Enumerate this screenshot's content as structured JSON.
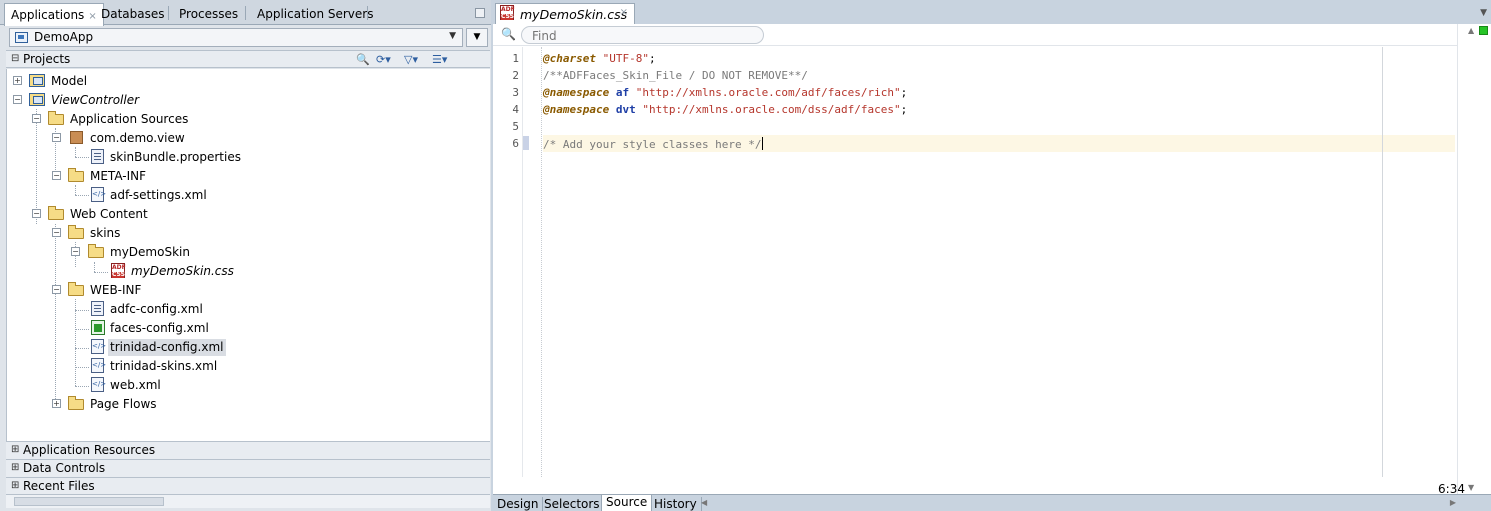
{
  "left_panel": {
    "tabs": [
      {
        "label": "Applications",
        "active": true,
        "close": "×"
      },
      {
        "label": "Databases",
        "active": false
      },
      {
        "label": "Processes",
        "active": false
      },
      {
        "label": "Application Servers",
        "active": false
      }
    ],
    "application": "DemoApp",
    "projects_label": "Projects",
    "tree": {
      "model": "Model",
      "view_controller": "ViewController",
      "application_sources": "Application Sources",
      "com_demo_view": "com.demo.view",
      "skin_bundle": "skinBundle.properties",
      "meta_inf": "META-INF",
      "adf_settings": "adf-settings.xml",
      "web_content": "Web Content",
      "skins": "skins",
      "my_demo_skin_folder": "myDemoSkin",
      "my_demo_skin_css": "myDemoSkin.css",
      "web_inf": "WEB-INF",
      "adfc_config": "adfc-config.xml",
      "faces_config": "faces-config.xml",
      "trinidad_config": "trinidad-config.xml",
      "trinidad_skins": "trinidad-skins.xml",
      "web_xml": "web.xml",
      "page_flows": "Page Flows"
    },
    "accordions": {
      "application_resources": "Application Resources",
      "data_controls": "Data Controls",
      "recent_files": "Recent Files"
    }
  },
  "editor": {
    "tab_label": "myDemoSkin.css",
    "tab_close": "×",
    "file_icon_text": "ADF",
    "file_icon_subtext": "CSS",
    "find_placeholder": "Find",
    "line_numbers": [
      "1",
      "2",
      "3",
      "4",
      "5",
      "6"
    ],
    "code": {
      "l1_kw": "@charset",
      "l1_str": "\"UTF-8\"",
      "l1_end": ";",
      "l2_comment": "/**ADFFaces_Skin_File / DO NOT REMOVE**/",
      "l3_kw": "@namespace",
      "l3_id": "af",
      "l3_str": "\"http://xmlns.oracle.com/adf/faces/rich\"",
      "l3_end": ";",
      "l4_kw": "@namespace",
      "l4_id": "dvt",
      "l4_str": "\"http://xmlns.oracle.com/dss/adf/faces\"",
      "l4_end": ";",
      "l6_comment": "/* Add your style classes here */"
    },
    "cursor_position": "6:34",
    "bottom_tabs": [
      {
        "label": "Design",
        "active": false
      },
      {
        "label": "Selectors",
        "active": false
      },
      {
        "label": "Source",
        "active": true
      },
      {
        "label": "History",
        "active": false
      }
    ]
  },
  "colors": {
    "keyword": "#8a5a00",
    "string": "#b5362c",
    "comment": "#7a7a7a",
    "status_ok": "#27c427"
  }
}
